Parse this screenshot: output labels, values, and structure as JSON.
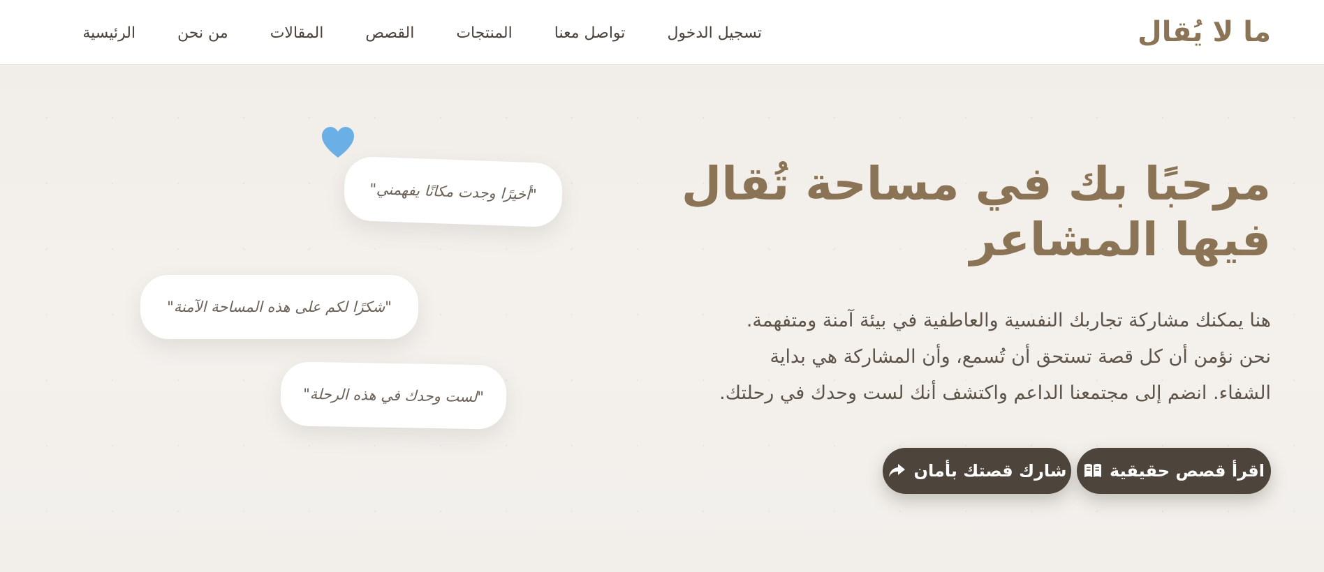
{
  "nav": {
    "logo": "ما لا يُقال",
    "links": [
      "الرئيسية",
      "من نحن",
      "المقالات",
      "القصص",
      "المنتجات",
      "تواصل معنا",
      "تسجيل الدخول"
    ]
  },
  "hero": {
    "title_line1": "مرحبًا بك في مساحة تُقال",
    "title_line2": "فيها المشاعر",
    "desc_line1": "هنا يمكنك مشاركة تجاربك النفسية والعاطفية في بيئة آمنة ومتفهمة.",
    "desc_line2": "نحن نؤمن أن كل قصة تستحق أن تُسمع، وأن المشاركة هي بداية",
    "desc_line3": "الشفاء. انضم إلى مجتمعنا الداعم واكتشف أنك لست وحدك في رحلتك.",
    "buttons": {
      "read": "اقرأ قصص حقيقية",
      "share": "شارك قصتك بأمان"
    }
  },
  "quotes": [
    "\"أخيرًا وجدت مكانًا يفهمني\"",
    "\"شكرًا لكم على هذه المساحة الآمنة\"",
    "\"لست وحدك في هذه الرحلة\""
  ],
  "colors": {
    "brand": "#8b7355",
    "button_bg": "#4d453b",
    "heart": "#6aafe6",
    "background": "#f3f0ec"
  },
  "icons": {
    "read_button": "book-open-icon",
    "share_button": "share-arrow-icon",
    "decoration": "heart-icon"
  }
}
